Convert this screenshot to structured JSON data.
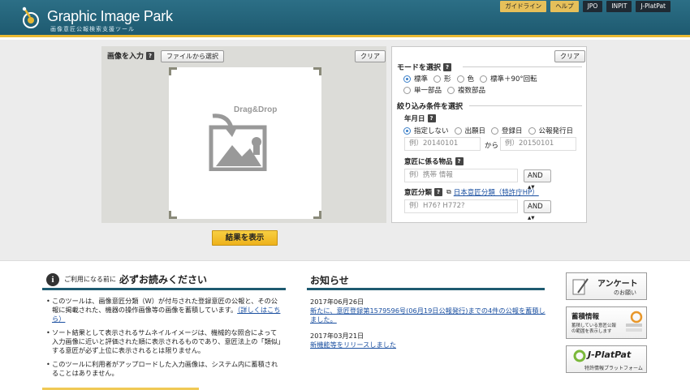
{
  "header": {
    "title": "Graphic Image Park",
    "subtitle": "画像意匠公報検索支援ツール",
    "links": [
      "ガイドライン",
      "ヘルプ",
      "JPO",
      "INPIT",
      "J-PlatPat"
    ]
  },
  "image_input": {
    "label": "画像を入力",
    "help": "?",
    "file_button": "ファイルから選択",
    "clear_button": "クリア",
    "drop_text": "Drag&Drop"
  },
  "mode_panel": {
    "clear_button": "クリア",
    "mode_title": "モードを選択",
    "mode_options": [
      "標準",
      "形",
      "色",
      "標準＋90°回転",
      "単一部品",
      "複数部品"
    ],
    "mode_selected": "標準",
    "filter_title": "絞り込み条件を選択",
    "date_label": "年月日",
    "date_options": [
      "指定しない",
      "出願日",
      "登録日",
      "公報発行日"
    ],
    "date_selected": "指定しない",
    "date_from_placeholder": "例）20140101",
    "date_separator": "から",
    "date_to_placeholder": "例）20150101",
    "article_label": "意匠に係る物品",
    "article_placeholder": "例）携帯 情報",
    "article_op": "AND",
    "class_label": "意匠分類",
    "class_link": "日本意匠分類（特許庁HP）",
    "class_placeholder": "例）H76? H772?",
    "class_op": "AND"
  },
  "show_button": "結果を表示",
  "notice": {
    "prefix": "ご利用になる前に",
    "title": "必ずお読みください",
    "bullets": [
      {
        "text": "このツールは、画像意匠分類（W）が付与された登録意匠の公報と、その公報に掲載された、機器の操作画像等の画像を蓄積しています。",
        "link": "（詳しくはこちら）"
      },
      {
        "text": "ソート結果として表示されるサムネイルイメージは、機械的な照合によって入力画像に近いと評価された順に表示されるものであり、意匠法上の「類似」する意匠が必ず上位に表示されるとは限りません。",
        "link": ""
      },
      {
        "text": "このツールに利用者がアップロードした入力画像は、システム内に蓄積されることはありません。",
        "link": ""
      }
    ]
  },
  "news": {
    "title": "お知らせ",
    "items": [
      {
        "date": "2017年06月26日",
        "text": "新たに、意匠登録第1579596号(06月19日公報発行)までの4件の公報を蓄積しました。"
      },
      {
        "date": "2017年03月21日",
        "text": "新機能等をリリースしました"
      }
    ]
  },
  "side": {
    "survey_title": "アンケート",
    "survey_sub": "のお願い",
    "stock_title": "蓄積情報",
    "stock_sub": "蓄積している意匠公報の範囲を表示します",
    "jpp_title": "J-PlatPat",
    "jpp_sub": "特許情報プラットフォーム"
  },
  "colors": {
    "header": "#1e5a70",
    "accent": "#e9b933",
    "link": "#1a4fa0"
  }
}
